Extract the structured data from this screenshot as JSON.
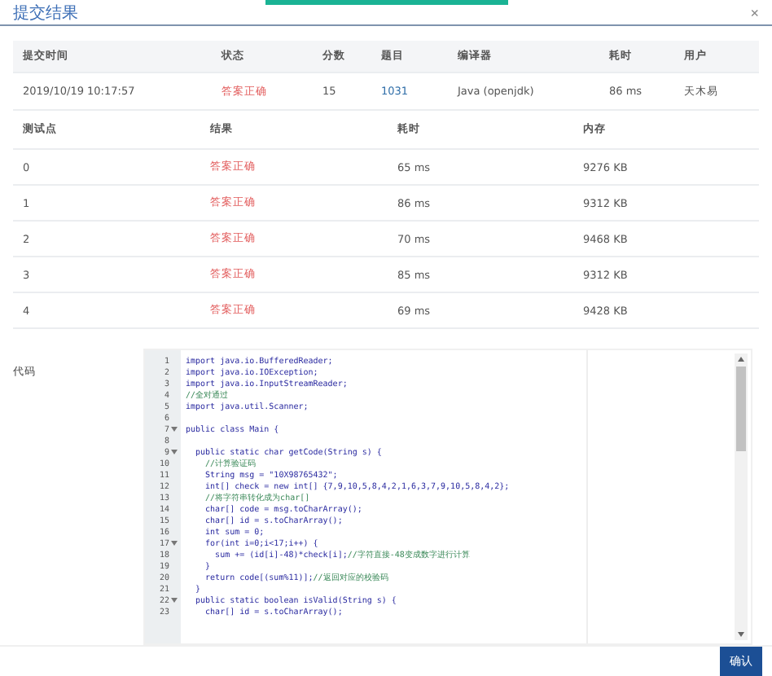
{
  "dialog": {
    "title": "提交结果",
    "close": "×"
  },
  "submission": {
    "columns": [
      "提交时间",
      "状态",
      "分数",
      "题目",
      "编译器",
      "耗时",
      "用户"
    ],
    "row": {
      "time": "2019/10/19 10:17:57",
      "status": "答案正确",
      "score": "15",
      "problem": "1031",
      "compiler": "Java (openjdk)",
      "runtime": "86 ms",
      "user": "天木易"
    }
  },
  "tests": {
    "columns": [
      "测试点",
      "结果",
      "耗时",
      "内存"
    ],
    "rows": [
      {
        "case": "0",
        "result": "答案正确",
        "time": "65 ms",
        "memory": "9276 KB"
      },
      {
        "case": "1",
        "result": "答案正确",
        "time": "86 ms",
        "memory": "9312 KB"
      },
      {
        "case": "2",
        "result": "答案正确",
        "time": "70 ms",
        "memory": "9468 KB"
      },
      {
        "case": "3",
        "result": "答案正确",
        "time": "85 ms",
        "memory": "9312 KB"
      },
      {
        "case": "4",
        "result": "答案正确",
        "time": "69 ms",
        "memory": "9428 KB"
      }
    ]
  },
  "code": {
    "label": "代码",
    "lines": [
      {
        "num": "1",
        "fold": false,
        "code": "import java.io.BufferedReader;"
      },
      {
        "num": "2",
        "fold": false,
        "code": "import java.io.IOException;"
      },
      {
        "num": "3",
        "fold": false,
        "code": "import java.io.InputStreamReader;"
      },
      {
        "num": "4",
        "fold": false,
        "comment": "//全对通过"
      },
      {
        "num": "5",
        "fold": false,
        "code": "import java.util.Scanner;"
      },
      {
        "num": "6",
        "fold": false
      },
      {
        "num": "7",
        "fold": true,
        "code": "public class Main {"
      },
      {
        "num": "8",
        "fold": false
      },
      {
        "num": "9",
        "fold": true,
        "code": "  public static char getCode(String s) {"
      },
      {
        "num": "10",
        "fold": false,
        "comment": "    //计算验证码"
      },
      {
        "num": "11",
        "fold": false,
        "code": "    String msg = \"10X98765432\";"
      },
      {
        "num": "12",
        "fold": false,
        "code": "    int[] check = new int[] {7,9,10,5,8,4,2,1,6,3,7,9,10,5,8,4,2};"
      },
      {
        "num": "13",
        "fold": false,
        "comment": "    //将字符串转化成为char[]"
      },
      {
        "num": "14",
        "fold": false,
        "code": "    char[] code = msg.toCharArray();"
      },
      {
        "num": "15",
        "fold": false,
        "code": "    char[] id = s.toCharArray();"
      },
      {
        "num": "16",
        "fold": false,
        "code": "    int sum = 0;"
      },
      {
        "num": "17",
        "fold": true,
        "code": "    for(int i=0;i<17;i++) {"
      },
      {
        "num": "18",
        "fold": false,
        "code": "      sum += (id[i]-48)*check[i];",
        "comment": "//字符直接-48变成数字进行计算"
      },
      {
        "num": "19",
        "fold": false,
        "code": "    }"
      },
      {
        "num": "20",
        "fold": false,
        "code": "    return code[(sum%11)];",
        "comment": "//返回对应的校验码"
      },
      {
        "num": "21",
        "fold": false,
        "code": "  }"
      },
      {
        "num": "22",
        "fold": true,
        "code": "  public static boolean isValid(String s) {"
      },
      {
        "num": "23",
        "fold": false,
        "code": "    char[] id = s.toCharArray();"
      }
    ]
  },
  "footer": {
    "confirm": "确认"
  }
}
